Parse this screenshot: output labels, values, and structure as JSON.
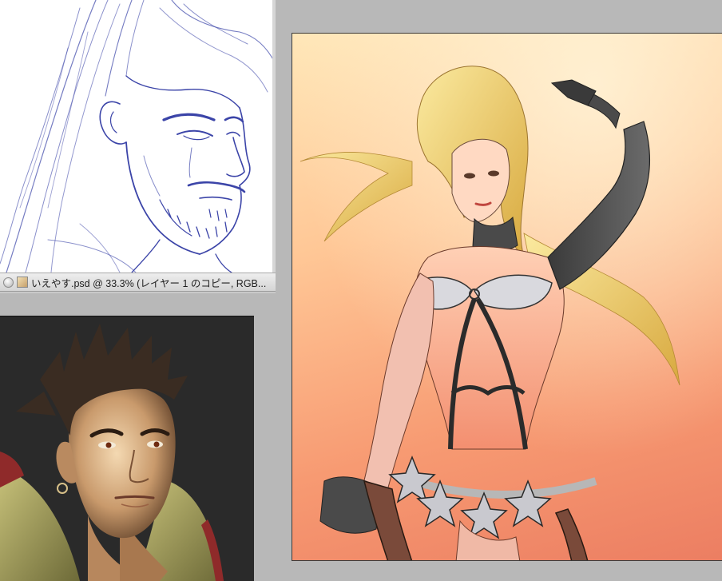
{
  "windows": {
    "sketch": {
      "title": "いえやす.psd @ 33.3% (レイヤー 1 のコピー, RGB...",
      "kind": "line sketch",
      "line_color": "#3b44a8"
    },
    "portrait": {
      "kind": "colored portrait",
      "background_color": "#2b2b2b"
    },
    "painting": {
      "kind": "colored painting",
      "gradient_colors": [
        "#ffe7b8",
        "#ffc796",
        "#f79a72",
        "#ec7e62"
      ]
    }
  },
  "icons": {
    "close": "close-icon",
    "thumbnail": "document-thumbnail-icon"
  },
  "colors": {
    "workspace": "#b8b8b8",
    "status_bar": "#e2e2e2"
  }
}
